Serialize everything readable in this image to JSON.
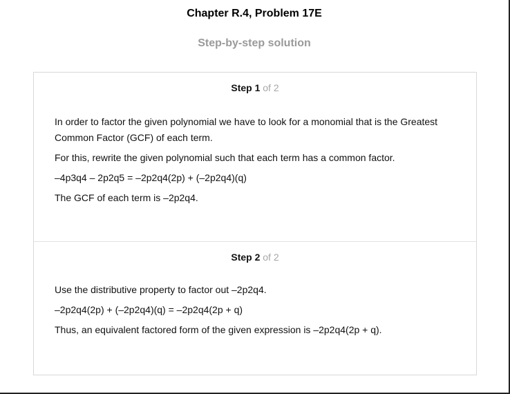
{
  "header": {
    "title": "Chapter R.4, Problem 17E",
    "subtitle": "Step-by-step solution"
  },
  "steps": [
    {
      "label": "Step 1",
      "of": " of 2",
      "paragraphs": [
        "In order to factor the given polynomial we have to look for a monomial that is the Greatest Common Factor (GCF) of each term.",
        "For this, rewrite the given polynomial such that each term has a common factor.",
        "–4p3q4 – 2p2q5 = –2p2q4(2p) + (–2p2q4)(q)",
        "The GCF of each term is –2p2q4."
      ]
    },
    {
      "label": "Step 2",
      "of": " of 2",
      "paragraphs": [
        "Use the distributive property to factor out –2p2q4.",
        "–2p2q4(2p) + (–2p2q4)(q) = –2p2q4(2p + q)",
        "Thus, an equivalent factored form of the given expression is –2p2q4(2p + q)."
      ]
    }
  ]
}
